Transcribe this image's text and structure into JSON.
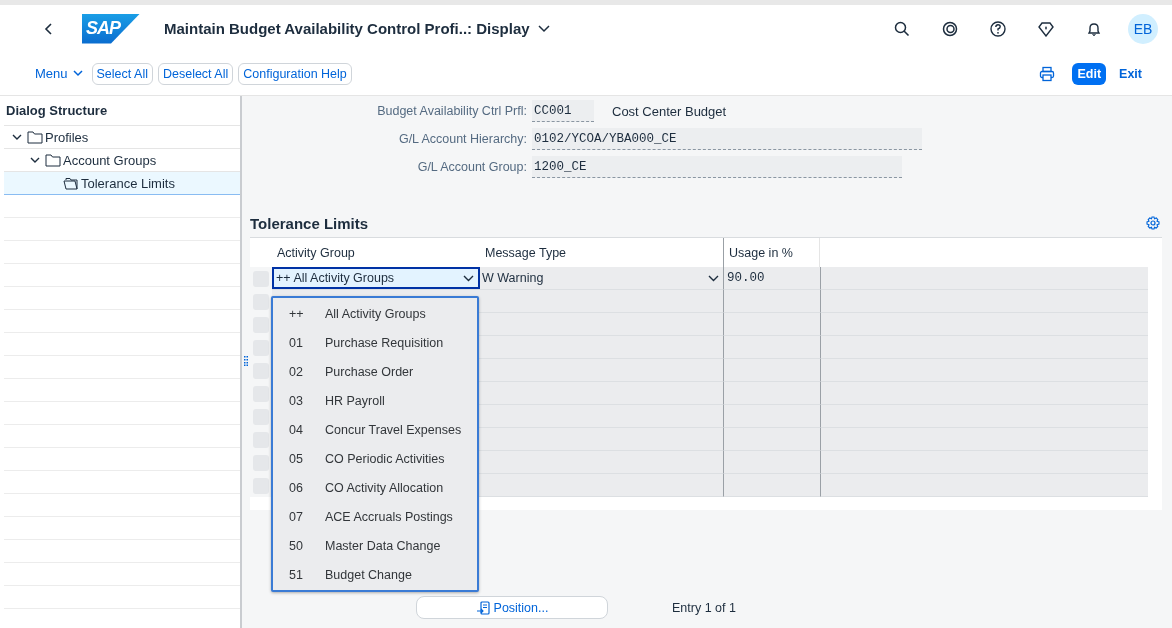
{
  "header": {
    "logo": "SAP",
    "title": "Maintain Budget Availability Control Profi..: Display",
    "avatar": "EB"
  },
  "toolbar": {
    "menu": "Menu",
    "buttons": [
      "Select All",
      "Deselect All",
      "Configuration Help"
    ],
    "edit": "Edit",
    "exit": "Exit"
  },
  "dialog_structure": {
    "title": "Dialog Structure",
    "items": [
      {
        "label": "Profiles",
        "expanded": true,
        "selected": false,
        "children": [
          {
            "label": "Account Groups",
            "expanded": true,
            "selected": false,
            "children": [
              {
                "label": "Tolerance Limits",
                "selected": true
              }
            ]
          }
        ]
      }
    ]
  },
  "fields": [
    {
      "label": "Budget Availability Ctrl Prfl:",
      "value": "CC001",
      "description": "Cost Center Budget"
    },
    {
      "label": "G/L Account Hierarchy:",
      "value": "0102/YCOA/YBA000_CE"
    },
    {
      "label": "G/L Account Group:",
      "value": "1200_CE"
    }
  ],
  "table": {
    "title": "Tolerance Limits",
    "columns": [
      "Activity Group",
      "Message Type",
      "Usage in %"
    ],
    "rows": [
      {
        "activity_group": "++ All Activity Groups",
        "message_type": "W Warning",
        "usage": "90.00",
        "focused": true
      }
    ]
  },
  "dropdown": {
    "options": [
      {
        "code": "++",
        "text": "All Activity Groups"
      },
      {
        "code": "01",
        "text": "Purchase Requisition"
      },
      {
        "code": "02",
        "text": "Purchase Order"
      },
      {
        "code": "03",
        "text": "HR Payroll"
      },
      {
        "code": "04",
        "text": "Concur Travel Expenses"
      },
      {
        "code": "05",
        "text": "CO Periodic Activities"
      },
      {
        "code": "06",
        "text": "CO Activity Allocation"
      },
      {
        "code": "07",
        "text": "ACE Accruals Postings"
      },
      {
        "code": "50",
        "text": "Master Data Change"
      },
      {
        "code": "51",
        "text": "Budget Change"
      }
    ]
  },
  "footer": {
    "position": "Position...",
    "entry": "Entry 1 of 1"
  }
}
